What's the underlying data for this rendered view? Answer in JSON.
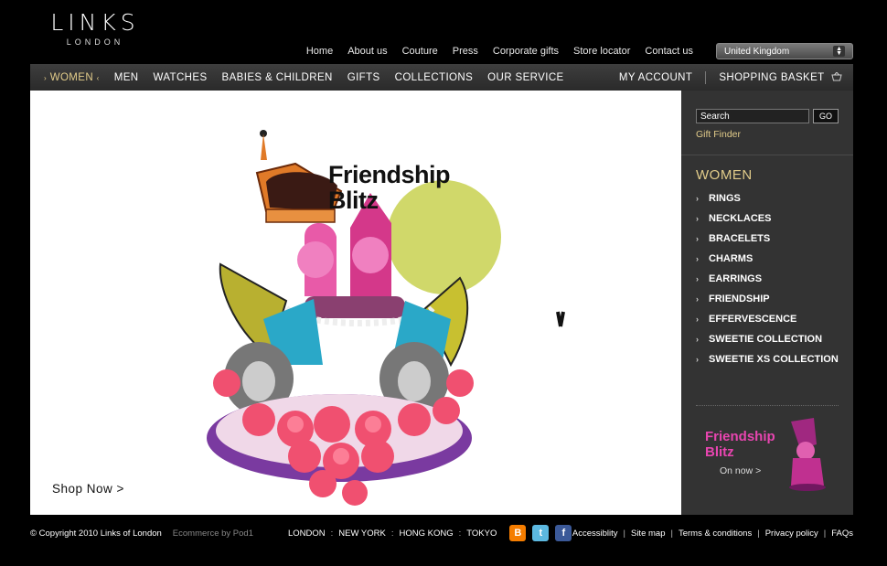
{
  "brand": {
    "name": "LINKS",
    "sub": "LONDON"
  },
  "topnav": [
    "Home",
    "About us",
    "Couture",
    "Press",
    "Corporate gifts",
    "Store locator",
    "Contact us"
  ],
  "country": {
    "selected": "United Kingdom"
  },
  "mainnav": {
    "left": [
      "WOMEN",
      "MEN",
      "WATCHES",
      "BABIES & CHILDREN",
      "GIFTS",
      "COLLECTIONS",
      "OUR SERVICE"
    ],
    "active": "WOMEN",
    "right": [
      "MY ACCOUNT",
      "SHOPPING BASKET"
    ]
  },
  "hero": {
    "title_line1": "Friendship",
    "title_line2": "Blitz",
    "cta": "Shop Now >"
  },
  "sidebar": {
    "search_value": "Search",
    "go_label": "GO",
    "gift_finder": "Gift Finder",
    "category_title": "WOMEN",
    "categories": [
      "RINGS",
      "NECKLACES",
      "BRACELETS",
      "CHARMS",
      "EARRINGS",
      "FRIENDSHIP",
      "EFFERVESCENCE",
      "SWEETIE COLLECTION",
      "SWEETIE XS COLLECTION"
    ],
    "promo": {
      "line1": "Friendship",
      "line2": "Blitz",
      "cta": "On now >"
    }
  },
  "footer": {
    "copyright": "© Copyright 2010 Links of London",
    "ecommerce": "Ecommerce by Pod1",
    "cities": [
      "LONDON",
      "NEW YORK",
      "HONG KONG",
      "TOKYO"
    ],
    "links": [
      "Accessiblity",
      "Site map",
      "Terms & conditions",
      "Privacy policy",
      "FAQs"
    ]
  },
  "colors": {
    "accent": "#e2cc8a",
    "promo_pink": "#e845b0",
    "hero_circle": "#d0d86a"
  }
}
